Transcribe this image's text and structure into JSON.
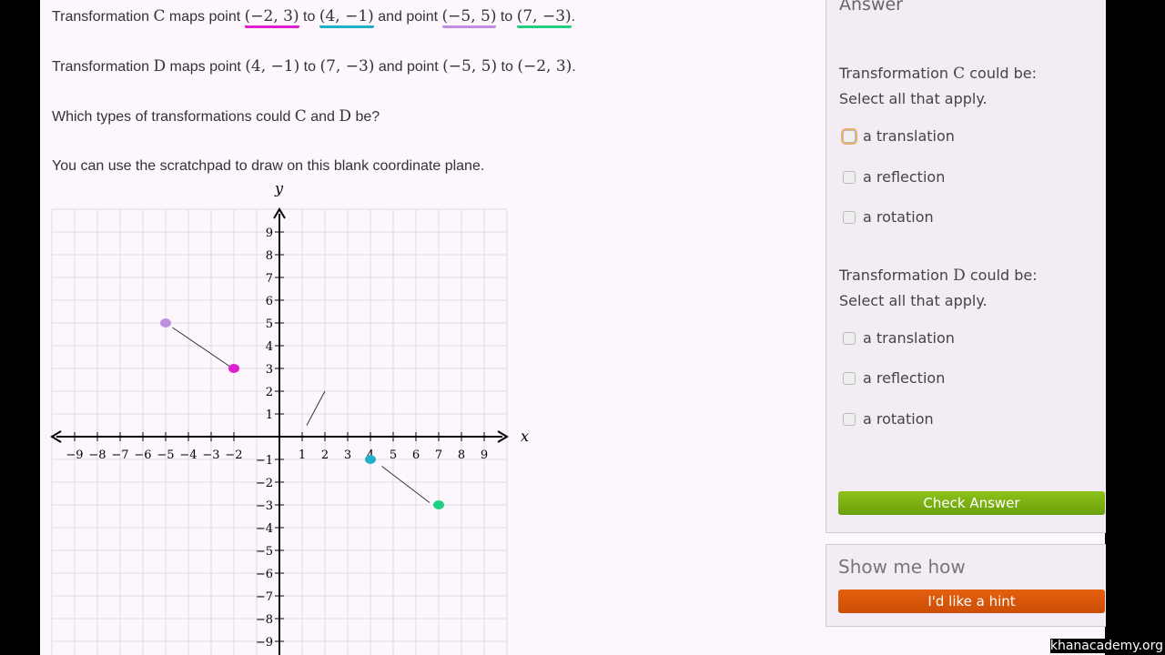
{
  "question": {
    "line1": {
      "a": "Transformation ",
      "t": "C",
      "b": " maps point ",
      "p1": "(−2, 3)",
      "c": " to ",
      "p2": "(4, −1)",
      "d": " and point ",
      "p3": "(−5, 5)",
      "e": " to ",
      "p4": "(7, −3)",
      "f": "."
    },
    "line2": {
      "a": "Transformation ",
      "t": "D",
      "b": " maps point ",
      "p1": "(4, −1)",
      "c": " to ",
      "p2": "(7, −3)",
      "d": " and point ",
      "p3": "(−5, 5)",
      "e": " to ",
      "p4": "(−2, 3)",
      "f": "."
    },
    "line3": {
      "a": "Which types of transformations could ",
      "c": "C",
      "b": " and ",
      "d": "D",
      "e": " be?"
    },
    "line4": "You can use the scratchpad to draw on this blank coordinate plane."
  },
  "underline_colors": [
    "#e020d0",
    "#20b0c8",
    "#c090e0",
    "#20d080"
  ],
  "chart_data": {
    "type": "scatter",
    "xlabel": "x",
    "ylabel": "y",
    "xlim": [
      -10,
      10
    ],
    "ylim": [
      -10,
      10
    ],
    "grid": true,
    "x_ticks": [
      -9,
      -8,
      -7,
      -6,
      -5,
      -4,
      -3,
      -2,
      1,
      2,
      3,
      4,
      5,
      6,
      7,
      8,
      9
    ],
    "y_ticks": [
      9,
      8,
      7,
      6,
      5,
      4,
      3,
      2,
      1,
      -1,
      -2,
      -3,
      -4,
      -5,
      -6,
      -7,
      -8,
      -9
    ],
    "points": [
      {
        "x": -5,
        "y": 5,
        "color": "#c090e0"
      },
      {
        "x": -2,
        "y": 3,
        "color": "#e020d0"
      },
      {
        "x": 4,
        "y": -1,
        "color": "#20b0c8"
      },
      {
        "x": 7,
        "y": -3,
        "color": "#20d080"
      }
    ]
  },
  "answer": {
    "title": "Answer",
    "c": {
      "label_a": "Transformation ",
      "label_t": "C",
      "label_b": " could be:",
      "sub": "Select all that apply.",
      "options": [
        "a translation",
        "a reflection",
        "a rotation"
      ]
    },
    "d": {
      "label_a": "Transformation ",
      "label_t": "D",
      "label_b": " could be:",
      "sub": "Select all that apply.",
      "options": [
        "a translation",
        "a reflection",
        "a rotation"
      ]
    },
    "check": "Check Answer"
  },
  "help": {
    "title": "Show me how",
    "hint": "I'd like a hint"
  },
  "watermark": "khanacademy.org"
}
